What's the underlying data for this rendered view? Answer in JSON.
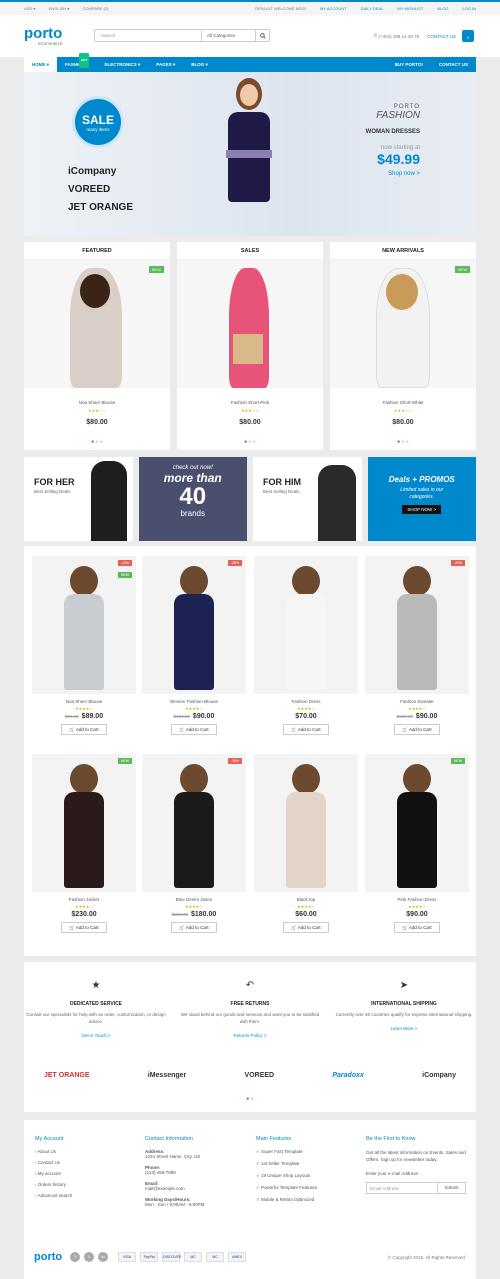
{
  "topbar": {
    "currency": "USD ▾",
    "language": "ENGLISH ▾",
    "compare": "COMPARE (2)",
    "welcome": "DEFAULT WELCOME MSG!",
    "links": [
      "MY ACCOUNT",
      "DAILY DEAL",
      "MY WISHLIST",
      "BLOG",
      "LOG IN"
    ]
  },
  "header": {
    "logo": "porto",
    "logo_sub": "eCommerce",
    "search_placeholder": "Search",
    "category": "All Categories",
    "phone": "(+404) 158 14 25 78",
    "contact": "CONTACT US",
    "cart_count": "2"
  },
  "nav": {
    "items": [
      "HOME ▾",
      "FASHION ▾",
      "ELECTRONICS ▾",
      "PAGES ▾",
      "BLOG ▾"
    ],
    "hot": "HOT",
    "right": [
      "BUY PORTO!",
      "CONTACT US"
    ]
  },
  "hero": {
    "sale": "SALE",
    "sale_sub": "many items",
    "brands": [
      "iCompany",
      "VOREED",
      "JET ORANGE"
    ],
    "line1": "PORTO",
    "line2": "FASHION",
    "line3": "WOMAN DRESSES",
    "line4": "now starting at",
    "price": "$49.99",
    "cta": "Shop now >"
  },
  "featured": [
    {
      "heading": "FEATURED",
      "badge": "NEW",
      "name": "Noa Sheer Blouse",
      "price": "$80.00"
    },
    {
      "heading": "SALES",
      "badge": "",
      "name": "Fashion Short-Pink",
      "price": "$80.00"
    },
    {
      "heading": "NEW ARRIVALS",
      "badge": "NEW",
      "name": "Fashion Short-White",
      "price": "$80.00"
    }
  ],
  "banners": {
    "b1_title": "FOR HER",
    "b1_sub": "Best Selling Deals",
    "b2_l1": "check out now!",
    "b2_l2": "more than",
    "b2_l3": "40",
    "b2_l4": "brands",
    "b3_title": "FOR HIM",
    "b3_sub": "Best Selling Deals",
    "b4_l1": "Deals + PROMOS",
    "b4_l2": "Limited sales in our categories.",
    "b4_btn": "SHOP NOW >"
  },
  "products": [
    {
      "name": "Noa Sheer Blouse",
      "old": "$99.00",
      "price": "$89.00",
      "tag": "-10%",
      "tag2": "NEW"
    },
    {
      "name": "Women Fashion-Blouse",
      "old": "$120.00",
      "price": "$90.00",
      "tag": "-25%",
      "tag2": ""
    },
    {
      "name": "Fashion Dress",
      "old": "",
      "price": "$70.00",
      "tag": "",
      "tag2": ""
    },
    {
      "name": "Fashion Sweater",
      "old": "$100.00",
      "price": "$90.00",
      "tag": "-20%",
      "tag2": ""
    },
    {
      "name": "Fashion Jacket",
      "old": "",
      "price": "$230.00",
      "tag": "NEW",
      "tag2": ""
    },
    {
      "name": "Blue Denim Jeans",
      "old": "$220.00",
      "price": "$180.00",
      "tag": "-20%",
      "tag2": ""
    },
    {
      "name": "Black top",
      "old": "",
      "price": "$60.00",
      "tag": "",
      "tag2": ""
    },
    {
      "name": "Pink Fashion Dress",
      "old": "",
      "price": "$90.00",
      "tag": "NEW",
      "tag2": ""
    }
  ],
  "add_to_cart": "Add to Cart",
  "services": [
    {
      "title": "DEDICATED SERVICE",
      "desc": "Consult our specialists for help with an order, customization, or design advice.",
      "link": "Get in Touch >"
    },
    {
      "title": "FREE RETURNS",
      "desc": "We stand behind our goods and services and want you to be satisfied with them.",
      "link": "Returns Policy >"
    },
    {
      "title": "INTERNATIONAL SHIPPING",
      "desc": "Currently over 50 countries qualify for express international shipping.",
      "link": "Learn More >"
    }
  ],
  "partner_brands": [
    "JET ORANGE",
    "iMessenger",
    "VOREED",
    "Paradoxx",
    "iCompany"
  ],
  "footer": {
    "my_account": "My Account",
    "account_links": [
      "About Us",
      "Contact Us",
      "My account",
      "Orders history",
      "Advanced search"
    ],
    "contact": "Contact Information",
    "address_label": "Address:",
    "address": "1234 Street Name, City, US",
    "phone_label": "Phone:",
    "phone": "(123) 456-7890",
    "email_label": "Email:",
    "email": "mail@example.com",
    "hours_label": "Working Days/Hours:",
    "hours": "Mon - Sun / 9:00AM - 8:00PM",
    "features": "Main Features",
    "feature_links": [
      "Super Fast Template",
      "1st Seller Template",
      "19 Unique Shop Layouts",
      "Powerful Template Features",
      "Mobile & Retina Optimized"
    ],
    "newsletter": "Be the First to Know",
    "newsletter_text": "Get all the latest information on Events, Sales and Offers. Sign up for newsletter today.",
    "email_field_label": "Enter your e-mail Address:",
    "email_placeholder": "Email Address",
    "submit": "Submit",
    "copyright": "© Copyright 2016. All Rights Reserved.",
    "payments": [
      "VISA",
      "PayPal",
      "DISCOVER",
      "MC",
      "MC",
      "AMEX"
    ]
  },
  "colors": {
    "accent": "#0088cc",
    "new": "#5cb85c",
    "sale": "#e36159"
  }
}
